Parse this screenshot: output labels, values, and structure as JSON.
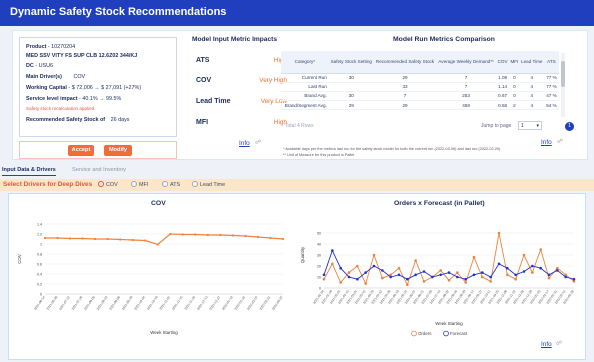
{
  "header": {
    "title": "Dynamic Safety Stock Recommendations"
  },
  "product_card": {
    "product_label": "Product",
    "product_id": "10270204",
    "product_name": "MED SSV VITY FS SUP CLB 12.6Z02 344/KJ",
    "dc_label": "DC",
    "dc_value": "USU6",
    "main_driver_label": "Main Driver(s)",
    "main_driver_value": "COV",
    "wc_label": "Working Capital",
    "wc_value": "$ 72,006 → $ 27,091 (+27%)",
    "sl_label": "Service level impact",
    "sl_value": "40.1% → 99.5%",
    "note": "Safety stock recalculation applied.",
    "rec_label": "Recommended Safety Stock of",
    "rec_value": "26",
    "rec_unit": "days",
    "accept_label": "Accept",
    "modify_label": "Modify"
  },
  "impacts": {
    "title": "Model Input Metric Impacts",
    "rows": [
      {
        "metric": "ATS",
        "level": "High"
      },
      {
        "metric": "COV",
        "level": "Very High"
      },
      {
        "metric": "Lead Time",
        "level": "Very Low"
      },
      {
        "metric": "MFI",
        "level": "High"
      }
    ],
    "info_label": "Info"
  },
  "metrics": {
    "title": "Model Run Metrics Comparison",
    "columns": [
      "Category*",
      "Safety Stock Setting",
      "Recommended Safety Stock",
      "Average Weekly Demand**",
      "COV",
      "MFI",
      "Lead Time",
      "ATS"
    ],
    "rows": [
      [
        "Current Run",
        "30",
        "29",
        "7",
        "1.09",
        "0",
        "4",
        "77 %"
      ],
      [
        "Last Run",
        "",
        "33",
        "7",
        "1.14",
        "0",
        "4",
        "77 %"
      ],
      [
        "Brand Avg.",
        "30",
        "7",
        "253",
        "0.67",
        "0",
        "4",
        "47 %"
      ],
      [
        "Brand/Segment Avg.",
        "29",
        "29",
        "458",
        "0.58",
        "2",
        "4",
        "54 %"
      ]
    ],
    "total_rows": "Total 4 Rows",
    "jump_label": "Jump to page",
    "page_value": "1",
    "page_badge": "1",
    "info_label": "Info",
    "footnotes": [
      "* Available days per the metrics last run for the safety stock model for both the current run (2022-03-06) and last run (2022-02-20)",
      "** Unit of Measure for this product is Pallet"
    ]
  },
  "tabs": {
    "active": "Input Data & Drivers",
    "inactive": "Service and Inventory"
  },
  "drivers": {
    "label": "Select Drivers for Deep Dives",
    "options": [
      "COV",
      "MFI",
      "ATS",
      "Lead Time"
    ],
    "selected": "COV"
  },
  "chart_data": [
    {
      "type": "line",
      "title": "COV",
      "xlabel": "Week Starting",
      "ylabel": "COV",
      "ylim": [
        0,
        1.4
      ],
      "yticks": [
        0,
        0.2,
        0.4,
        0.6,
        0.8,
        1.0,
        1.2,
        1.4
      ],
      "categories": [
        "2021-06-14",
        "2021-06-28",
        "2021-07-12",
        "2021-07-26",
        "2021-08-09",
        "2021-08-23",
        "2021-09-06",
        "2021-09-20",
        "2021-10-04",
        "2021-10-18",
        "2021-11-01",
        "2021-11-15",
        "2021-11-29",
        "2021-12-13",
        "2021-12-27",
        "2022-01-10",
        "2022-01-24",
        "2022-02-07",
        "2022-02-21",
        "2022-03-07"
      ],
      "series": [
        {
          "values": [
            1.12,
            1.12,
            1.11,
            1.11,
            1.1,
            1.1,
            1.09,
            1.08,
            1.07,
            0.99,
            1.2,
            1.19,
            1.19,
            1.18,
            1.18,
            1.17,
            1.16,
            1.14,
            1.12,
            1.1
          ],
          "color": "#f0823c"
        }
      ]
    },
    {
      "type": "line",
      "title": "Orders x Forecast (in Pallet)",
      "xlabel": "Week Starting",
      "ylabel": "Quantity",
      "ylim": [
        0,
        60
      ],
      "yticks": [
        0,
        10,
        20,
        30,
        40,
        50
      ],
      "categories": [
        "2021-01-04",
        "2021-01-18",
        "2021-02-01",
        "2021-02-15",
        "2021-03-01",
        "2021-03-15",
        "2021-03-29",
        "2021-04-12",
        "2021-04-26",
        "2021-05-10",
        "2021-05-24",
        "2021-06-07",
        "2021-06-21",
        "2021-07-05",
        "2021-07-19",
        "2021-08-02",
        "2021-08-16",
        "2021-08-30",
        "2021-09-13",
        "2021-09-27",
        "2021-10-11",
        "2021-10-25",
        "2021-11-08",
        "2021-11-22",
        "2021-12-06",
        "2021-12-20",
        "2022-01-03",
        "2022-01-17",
        "2022-01-31",
        "2022-02-14",
        "2022-02-28"
      ],
      "series": [
        {
          "name": "Orders",
          "color": "#f0823c",
          "values": [
            8,
            22,
            5,
            14,
            20,
            4,
            30,
            9,
            12,
            18,
            3,
            25,
            6,
            10,
            16,
            7,
            14,
            5,
            28,
            10,
            6,
            50,
            12,
            8,
            30,
            14,
            35,
            9,
            18,
            12,
            6
          ]
        },
        {
          "name": "Forecast",
          "color": "#2233c8",
          "values": [
            12,
            34,
            18,
            10,
            8,
            14,
            20,
            16,
            10,
            12,
            8,
            12,
            15,
            10,
            12,
            14,
            10,
            8,
            12,
            14,
            10,
            22,
            18,
            12,
            15,
            20,
            18,
            12,
            16,
            10,
            8
          ]
        }
      ],
      "legend": "bottom"
    }
  ],
  "charts_info_label": "Info",
  "icons": {
    "info": "info-icon",
    "page": "page-badge"
  }
}
